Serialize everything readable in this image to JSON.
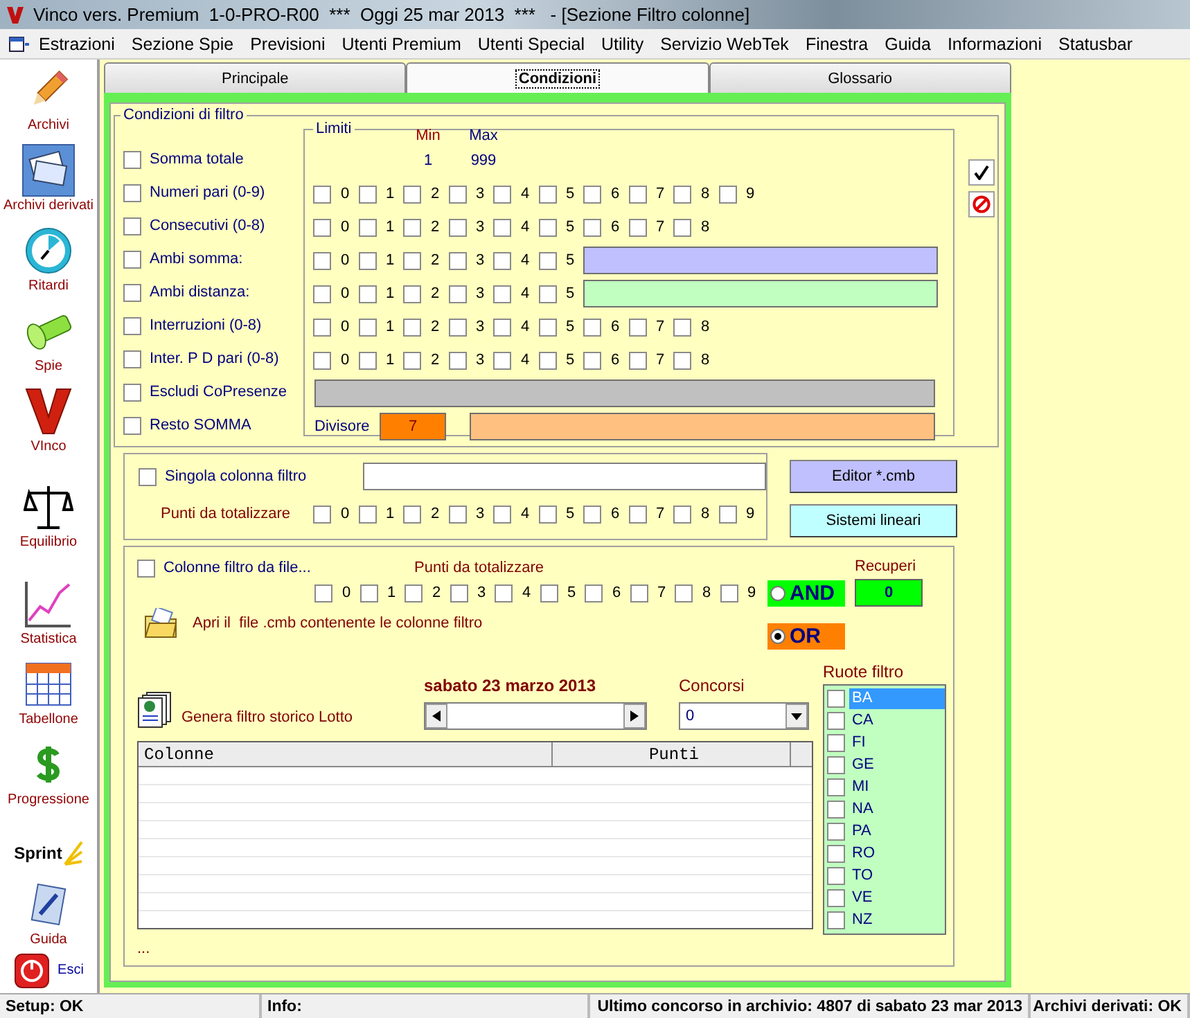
{
  "window": {
    "title": "Vinco vers. Premium  1-0-PRO-R00  ***  Oggi 25 mar 2013  ***   - [Sezione Filtro colonne]"
  },
  "menu": [
    "Estrazioni",
    "Sezione Spie",
    "Previsioni",
    "Utenti Premium",
    "Utenti Special",
    "Utility",
    "Servizio WebTek",
    "Finestra",
    "Guida",
    "Informazioni",
    "Statusbar"
  ],
  "sidebar": {
    "items": [
      {
        "kind": "stacked",
        "label": "Archivi",
        "selected": false
      },
      {
        "kind": "stacked",
        "label": "Archivi derivati",
        "selected": true
      },
      {
        "kind": "stacked",
        "label": "Ritardi",
        "selected": false
      },
      {
        "kind": "stacked",
        "label": "Spie",
        "selected": false
      },
      {
        "kind": "stacked",
        "label": "VInco",
        "selected": false
      },
      {
        "kind": "stacked",
        "label": "Equilibrio",
        "selected": false
      },
      {
        "kind": "stacked",
        "label": "Statistica",
        "selected": false
      },
      {
        "kind": "stacked",
        "label": "Tabellone",
        "selected": false
      },
      {
        "kind": "stacked",
        "label": "Progressione",
        "selected": false
      },
      {
        "kind": "logo",
        "label": "Sprint",
        "selected": false
      },
      {
        "kind": "stacked",
        "label": "Guida",
        "selected": false
      },
      {
        "kind": "inline",
        "label": "Esci",
        "selected": false
      }
    ]
  },
  "tabs": [
    {
      "label": "Principale",
      "selected": false
    },
    {
      "label": "Condizioni",
      "selected": true
    },
    {
      "label": "Glossario",
      "selected": false
    }
  ],
  "conditions": {
    "legend": "Condizioni di filtro",
    "limits_legend": "Limiti",
    "min_label": "Min",
    "max_label": "Max",
    "rows": [
      {
        "kind": "range",
        "label": "Somma totale",
        "checked": false,
        "min_value": "1",
        "max_value": "999"
      },
      {
        "kind": "digits",
        "label": "Numeri pari (0-9)",
        "checked": false,
        "digits": [
          {
            "label": "0",
            "checked": false
          },
          {
            "label": "1",
            "checked": false
          },
          {
            "label": "2",
            "checked": false
          },
          {
            "label": "3",
            "checked": false
          },
          {
            "label": "4",
            "checked": false
          },
          {
            "label": "5",
            "checked": false
          },
          {
            "label": "6",
            "checked": false
          },
          {
            "label": "7",
            "checked": false
          },
          {
            "label": "8",
            "checked": false
          },
          {
            "label": "9",
            "checked": false
          }
        ]
      },
      {
        "kind": "digits",
        "label": "Consecutivi (0-8)",
        "checked": false,
        "digits": [
          {
            "label": "0",
            "checked": false
          },
          {
            "label": "1",
            "checked": false
          },
          {
            "label": "2",
            "checked": false
          },
          {
            "label": "3",
            "checked": false
          },
          {
            "label": "4",
            "checked": false
          },
          {
            "label": "5",
            "checked": false
          },
          {
            "label": "6",
            "checked": false
          },
          {
            "label": "7",
            "checked": false
          },
          {
            "label": "8",
            "checked": false
          }
        ]
      },
      {
        "kind": "digits_bar",
        "label": "Ambi somma:",
        "checked": false,
        "color": "#c0c0ff",
        "digits": [
          {
            "label": "0",
            "checked": false
          },
          {
            "label": "1",
            "checked": false
          },
          {
            "label": "2",
            "checked": false
          },
          {
            "label": "3",
            "checked": false
          },
          {
            "label": "4",
            "checked": false
          },
          {
            "label": "5",
            "checked": false
          }
        ]
      },
      {
        "kind": "digits_bar",
        "label": "Ambi distanza:",
        "checked": false,
        "color": "#c0ffc0",
        "digits": [
          {
            "label": "0",
            "checked": false
          },
          {
            "label": "1",
            "checked": false
          },
          {
            "label": "2",
            "checked": false
          },
          {
            "label": "3",
            "checked": false
          },
          {
            "label": "4",
            "checked": false
          },
          {
            "label": "5",
            "checked": false
          }
        ]
      },
      {
        "kind": "digits",
        "label": "Interruzioni (0-8)",
        "checked": false,
        "digits": [
          {
            "label": "0",
            "checked": false
          },
          {
            "label": "1",
            "checked": false
          },
          {
            "label": "2",
            "checked": false
          },
          {
            "label": "3",
            "checked": false
          },
          {
            "label": "4",
            "checked": false
          },
          {
            "label": "5",
            "checked": false
          },
          {
            "label": "6",
            "checked": false
          },
          {
            "label": "7",
            "checked": false
          },
          {
            "label": "8",
            "checked": false
          }
        ]
      },
      {
        "kind": "digits",
        "label": "Inter. P D pari (0-8)",
        "checked": false,
        "digits": [
          {
            "label": "0",
            "checked": false
          },
          {
            "label": "1",
            "checked": false
          },
          {
            "label": "2",
            "checked": false
          },
          {
            "label": "3",
            "checked": false
          },
          {
            "label": "4",
            "checked": false
          },
          {
            "label": "5",
            "checked": false
          },
          {
            "label": "6",
            "checked": false
          },
          {
            "label": "7",
            "checked": false
          },
          {
            "label": "8",
            "checked": false
          }
        ]
      },
      {
        "kind": "bar",
        "label": "Escludi CoPresenze",
        "checked": false,
        "color": "#c0c0c0"
      },
      {
        "kind": "divisor",
        "label": "Resto SOMMA",
        "checked": false,
        "divisor_label": "Divisore",
        "divisor_value": "7",
        "color": "#ffc080"
      }
    ]
  },
  "single_column": {
    "label": "Singola colonna filtro",
    "checked": false,
    "points_label": "Punti da totalizzare",
    "digits": [
      {
        "label": "0",
        "checked": false
      },
      {
        "label": "1",
        "checked": false
      },
      {
        "label": "2",
        "checked": false
      },
      {
        "label": "3",
        "checked": false
      },
      {
        "label": "4",
        "checked": false
      },
      {
        "label": "5",
        "checked": false
      },
      {
        "label": "6",
        "checked": false
      },
      {
        "label": "7",
        "checked": false
      },
      {
        "label": "8",
        "checked": false
      },
      {
        "label": "9",
        "checked": false
      }
    ]
  },
  "buttons": [
    {
      "label": "Editor *.cmb",
      "color": "#c0c0ff"
    },
    {
      "label": "Sistemi lineari",
      "color": "#c0ffff"
    }
  ],
  "file_filter": {
    "label": "Colonne filtro da file...",
    "checked": false,
    "points_label": "Punti da totalizzare",
    "digits": [
      {
        "label": "0",
        "checked": false
      },
      {
        "label": "1",
        "checked": false
      },
      {
        "label": "2",
        "checked": false
      },
      {
        "label": "3",
        "checked": false
      },
      {
        "label": "4",
        "checked": false
      },
      {
        "label": "5",
        "checked": false
      },
      {
        "label": "6",
        "checked": false
      },
      {
        "label": "7",
        "checked": false
      },
      {
        "label": "8",
        "checked": false
      },
      {
        "label": "9",
        "checked": false
      }
    ],
    "open_file_text": "Apri il  file .cmb contenente le colonne filtro",
    "logic": [
      {
        "label": "AND",
        "selected": false,
        "color": "#00ff00"
      },
      {
        "label": "OR",
        "selected": true,
        "color": "#ff8000"
      }
    ],
    "recoveries_label": "Recuperi",
    "recoveries_value": "0",
    "generate_text": "Genera filtro storico Lotto",
    "date": "sabato 23 marzo 2013",
    "draws_label": "Concorsi",
    "draws_value": "0",
    "wheels_label": "Ruote filtro",
    "wheels": [
      {
        "label": "BA",
        "checked": false,
        "selected": true
      },
      {
        "label": "CA",
        "checked": false,
        "selected": false
      },
      {
        "label": "FI",
        "checked": false,
        "selected": false
      },
      {
        "label": "GE",
        "checked": false,
        "selected": false
      },
      {
        "label": "MI",
        "checked": false,
        "selected": false
      },
      {
        "label": "NA",
        "checked": false,
        "selected": false
      },
      {
        "label": "PA",
        "checked": false,
        "selected": false
      },
      {
        "label": "RO",
        "checked": false,
        "selected": false
      },
      {
        "label": "TO",
        "checked": false,
        "selected": false
      },
      {
        "label": "VE",
        "checked": false,
        "selected": false
      },
      {
        "label": "NZ",
        "checked": false,
        "selected": false
      }
    ],
    "table": {
      "columns": [
        "Colonne",
        "Punti"
      ]
    },
    "footer": "..."
  },
  "status_bar": [
    "Setup: OK",
    "Info:",
    "Ultimo concorso in archivio: 4807 di sabato 23 mar 2013",
    "Archivi derivati: OK"
  ]
}
